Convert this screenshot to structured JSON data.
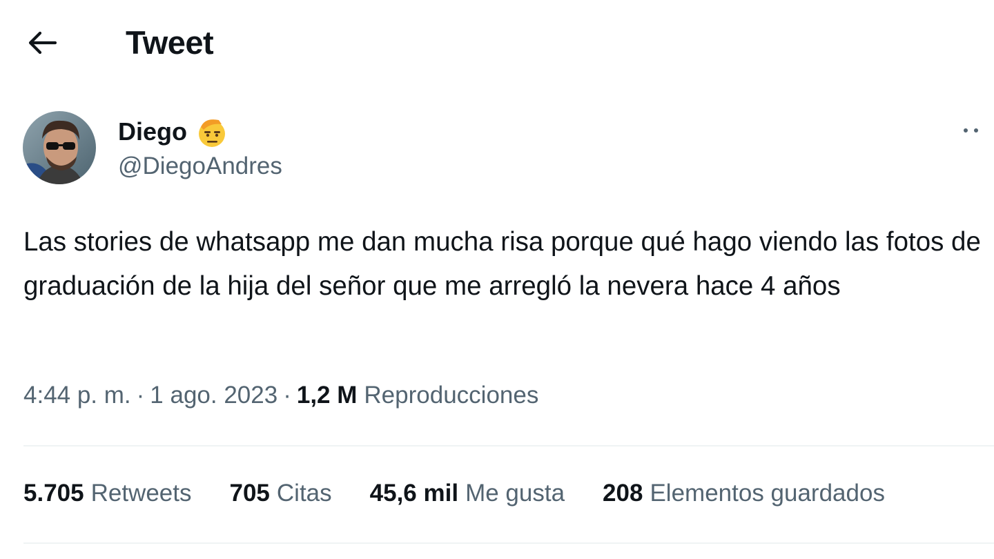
{
  "header": {
    "title": "Tweet",
    "back_icon": "arrow-left-icon"
  },
  "tweet": {
    "author": {
      "display_name": "Diego",
      "badge_emoji_icon": "saluting-face-emoji-icon",
      "handle": "@DiegoAndres"
    },
    "more_icon": "more-options-icon",
    "text": "Las stories de whatsapp me dan mucha risa porque qué hago viendo las fotos de graduación de la hija del señor que me arregló la nevera hace 4 años",
    "time": "4:44 p. m.",
    "date": "1 ago. 2023",
    "views_count": "1,2 M",
    "views_label": "Reproducciones"
  },
  "stats": [
    {
      "count": "5.705",
      "label": "Retweets"
    },
    {
      "count": "705",
      "label": "Citas"
    },
    {
      "count": "45,6 mil",
      "label": "Me gusta"
    },
    {
      "count": "208",
      "label": "Elementos guardados"
    }
  ],
  "colors": {
    "primary_text": "#0f1419",
    "secondary_text": "#536471",
    "divider": "#eff3f4",
    "background": "#ffffff"
  }
}
